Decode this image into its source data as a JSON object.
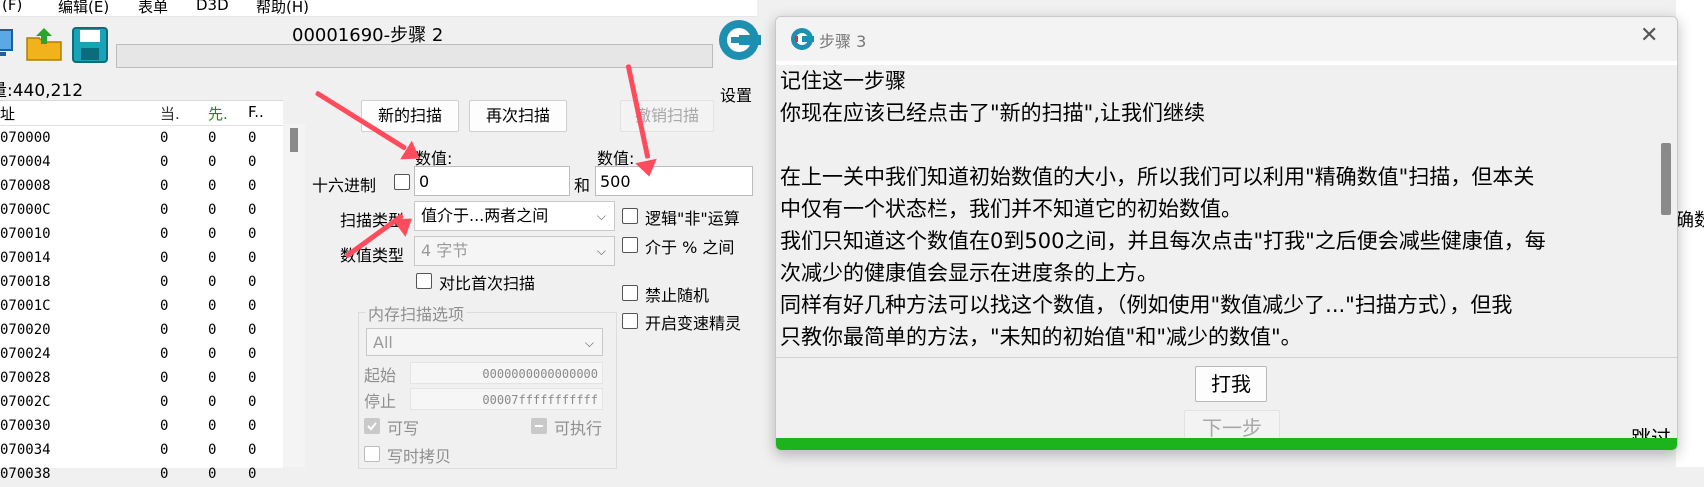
{
  "menu": [
    "(F)",
    "编辑(E)",
    "表单",
    "D3D",
    "帮助(H)"
  ],
  "window": {
    "title": "00001690-步骤 2"
  },
  "settings_label": "设置",
  "found_count": "量:440,212",
  "list": {
    "headers": [
      "址",
      "当.",
      "先.",
      "F.."
    ],
    "rows": [
      [
        "070000",
        "0",
        "0",
        "0"
      ],
      [
        "070004",
        "0",
        "0",
        "0"
      ],
      [
        "070008",
        "0",
        "0",
        "0"
      ],
      [
        "07000C",
        "0",
        "0",
        "0"
      ],
      [
        "070010",
        "0",
        "0",
        "0"
      ],
      [
        "070014",
        "0",
        "0",
        "0"
      ],
      [
        "070018",
        "0",
        "0",
        "0"
      ],
      [
        "07001C",
        "0",
        "0",
        "0"
      ],
      [
        "070020",
        "0",
        "0",
        "0"
      ],
      [
        "070024",
        "0",
        "0",
        "0"
      ],
      [
        "070028",
        "0",
        "0",
        "0"
      ],
      [
        "07002C",
        "0",
        "0",
        "0"
      ],
      [
        "070030",
        "0",
        "0",
        "0"
      ],
      [
        "070034",
        "0",
        "0",
        "0"
      ],
      [
        "070038",
        "0",
        "0",
        "0"
      ]
    ]
  },
  "buttons": {
    "new_scan": "新的扫描",
    "next_scan": "再次扫描",
    "undo_scan": "撤销扫描"
  },
  "value": {
    "label1": "数值:",
    "label2": "数值:",
    "hex_label": "十六进制",
    "and": "和",
    "value1": "0",
    "value2": "500"
  },
  "scan_type": {
    "label": "扫描类型",
    "selected": "值介于...两者之间"
  },
  "value_type": {
    "label": "数值类型",
    "selected": "4 字节"
  },
  "compare_first": "对比首次扫描",
  "options_right": {
    "logical_not": "逻辑\"非\"运算",
    "percent": "介于 % 之间",
    "no_random": "禁止随机",
    "speedhack": "开启变速精灵"
  },
  "memory": {
    "title": "内存扫描选项",
    "region": "All",
    "start_label": "起始",
    "start_value": "0000000000000000",
    "stop_label": "停止",
    "stop_value": "00007fffffffffff",
    "writable": "可写",
    "executable": "可执行",
    "cow": "写时拷贝"
  },
  "dialog": {
    "title": "步骤 3",
    "lines": [
      "记住这一步骤",
      "你现在应该已经点击了\"新的扫描\",让我们继续",
      "",
      "在上一关中我们知道初始数值的大小，所以我们可以利用\"精确数值\"扫描，但本关",
      "中仅有一个状态栏，我们并不知道它的初始数值。",
      "我们只知道这个数值在0到500之间，并且每次点击\"打我\"之后便会减些健康值，每",
      "次减少的健康值会显示在进度条的上方。",
      "同样有好几种方法可以找这个数值，（例如使用\"数值减少了...\"扫描方式），但我",
      "只教你最简单的方法，\"未知的初始值\"和\"减少的数值\"。"
    ],
    "hit_me": "打我",
    "next": "下一步",
    "skip": "跳过",
    "health_percent": 100
  },
  "right_edge": {
    "text": "确数"
  },
  "colors": {
    "arrow": "#ff4b5c",
    "progress": "#1db31d"
  }
}
